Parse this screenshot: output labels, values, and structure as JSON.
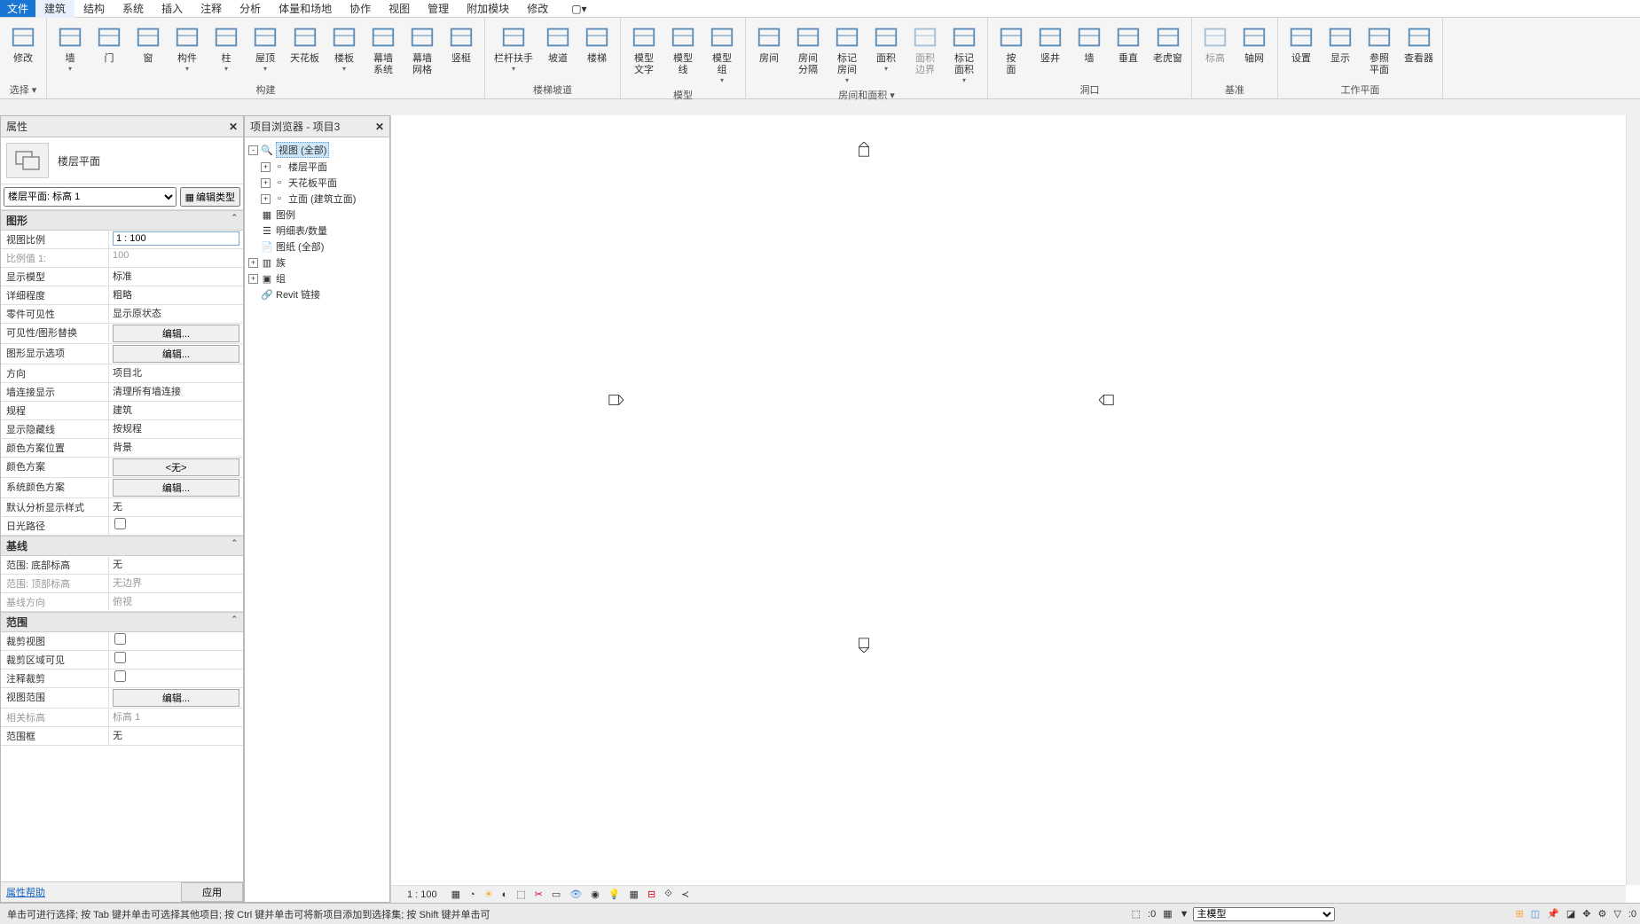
{
  "menu": {
    "file": "文件",
    "items": [
      "建筑",
      "结构",
      "系统",
      "插入",
      "注释",
      "分析",
      "体量和场地",
      "协作",
      "视图",
      "管理",
      "附加模块",
      "修改"
    ]
  },
  "ribbon": {
    "groups": [
      {
        "label": "选择 ▾",
        "buttons": [
          {
            "label": "修改",
            "icon": "cursor"
          }
        ]
      },
      {
        "label": "构建",
        "buttons": [
          {
            "label": "墙",
            "icon": "wall",
            "dd": true
          },
          {
            "label": "门",
            "icon": "door"
          },
          {
            "label": "窗",
            "icon": "window"
          },
          {
            "label": "构件",
            "icon": "component",
            "dd": true
          },
          {
            "label": "柱",
            "icon": "column",
            "dd": true
          },
          {
            "label": "屋顶",
            "icon": "roof",
            "dd": true
          },
          {
            "label": "天花板",
            "icon": "ceiling"
          },
          {
            "label": "楼板",
            "icon": "floor",
            "dd": true
          },
          {
            "label": "幕墙\n系统",
            "icon": "curtain-sys"
          },
          {
            "label": "幕墙\n网格",
            "icon": "curtain-grid"
          },
          {
            "label": "竖梃",
            "icon": "mullion"
          }
        ]
      },
      {
        "label": "楼梯坡道",
        "buttons": [
          {
            "label": "栏杆扶手",
            "icon": "railing",
            "dd": true
          },
          {
            "label": "坡道",
            "icon": "ramp"
          },
          {
            "label": "楼梯",
            "icon": "stair"
          }
        ]
      },
      {
        "label": "模型",
        "buttons": [
          {
            "label": "模型\n文字",
            "icon": "model-text"
          },
          {
            "label": "模型\n线",
            "icon": "model-line"
          },
          {
            "label": "模型\n组",
            "icon": "model-group",
            "dd": true
          }
        ]
      },
      {
        "label": "房间和面积 ▾",
        "buttons": [
          {
            "label": "房间",
            "icon": "room"
          },
          {
            "label": "房间\n分隔",
            "icon": "room-sep"
          },
          {
            "label": "标记\n房间",
            "icon": "tag-room",
            "dd": true
          },
          {
            "label": "面积",
            "icon": "area",
            "dd": true
          },
          {
            "label": "面积\n边界",
            "icon": "area-bound",
            "disabled": true
          },
          {
            "label": "标记\n面积",
            "icon": "tag-area",
            "dd": true
          }
        ]
      },
      {
        "label": "洞口",
        "buttons": [
          {
            "label": "按\n面",
            "icon": "by-face"
          },
          {
            "label": "竖井",
            "icon": "shaft"
          },
          {
            "label": "墙",
            "icon": "wall-open"
          },
          {
            "label": "垂直",
            "icon": "vertical"
          },
          {
            "label": "老虎窗",
            "icon": "dormer"
          }
        ]
      },
      {
        "label": "基准",
        "buttons": [
          {
            "label": "标高",
            "icon": "level",
            "disabled": true
          },
          {
            "label": "轴网",
            "icon": "grid"
          }
        ]
      },
      {
        "label": "工作平面",
        "buttons": [
          {
            "label": "设置",
            "icon": "set"
          },
          {
            "label": "显示",
            "icon": "show"
          },
          {
            "label": "参照\n平面",
            "icon": "ref-plane"
          },
          {
            "label": "查看器",
            "icon": "viewer"
          }
        ]
      }
    ]
  },
  "properties": {
    "title": "属性",
    "type_name": "楼层平面",
    "selector": "楼层平面: 标高 1",
    "edit_type": "编辑类型",
    "sections": [
      {
        "name": "图形",
        "rows": [
          {
            "k": "视图比例",
            "v": "1 : 100",
            "input": true
          },
          {
            "k": "比例值 1:",
            "v": "100",
            "dim": true
          },
          {
            "k": "显示模型",
            "v": "标准"
          },
          {
            "k": "详细程度",
            "v": "粗略"
          },
          {
            "k": "零件可见性",
            "v": "显示原状态"
          },
          {
            "k": "可见性/图形替换",
            "v": "编辑...",
            "btn": true
          },
          {
            "k": "图形显示选项",
            "v": "编辑...",
            "btn": true
          },
          {
            "k": "方向",
            "v": "项目北"
          },
          {
            "k": "墙连接显示",
            "v": "清理所有墙连接"
          },
          {
            "k": "规程",
            "v": "建筑"
          },
          {
            "k": "显示隐藏线",
            "v": "按规程"
          },
          {
            "k": "颜色方案位置",
            "v": "背景"
          },
          {
            "k": "颜色方案",
            "v": "<无>",
            "btn": true
          },
          {
            "k": "系统颜色方案",
            "v": "编辑...",
            "btn": true
          },
          {
            "k": "默认分析显示样式",
            "v": "无"
          },
          {
            "k": "日光路径",
            "v": "",
            "chk": true
          }
        ]
      },
      {
        "name": "基线",
        "rows": [
          {
            "k": "范围: 底部标高",
            "v": "无"
          },
          {
            "k": "范围: 顶部标高",
            "v": "无边界",
            "dim": true
          },
          {
            "k": "基线方向",
            "v": "俯视",
            "dim": true
          }
        ]
      },
      {
        "name": "范围",
        "rows": [
          {
            "k": "裁剪视图",
            "v": "",
            "chk": true
          },
          {
            "k": "裁剪区域可见",
            "v": "",
            "chk": true
          },
          {
            "k": "注释裁剪",
            "v": "",
            "chk": true
          },
          {
            "k": "视图范围",
            "v": "编辑...",
            "btn": true
          },
          {
            "k": "相关标高",
            "v": "标高 1",
            "dim": true
          },
          {
            "k": "范围框",
            "v": "无"
          }
        ]
      }
    ],
    "help": "属性帮助",
    "apply": "应用"
  },
  "browser": {
    "title": "项目浏览器 - 项目3",
    "tree": [
      {
        "label": "视图 (全部)",
        "icon": "views",
        "exp": "-",
        "indent": 0,
        "sel": true
      },
      {
        "label": "楼层平面",
        "icon": "none",
        "exp": "+",
        "indent": 1
      },
      {
        "label": "天花板平面",
        "icon": "none",
        "exp": "+",
        "indent": 1
      },
      {
        "label": "立面 (建筑立面)",
        "icon": "none",
        "exp": "+",
        "indent": 1
      },
      {
        "label": "图例",
        "icon": "legend",
        "exp": "",
        "indent": 0
      },
      {
        "label": "明细表/数量",
        "icon": "schedule",
        "exp": "",
        "indent": 0
      },
      {
        "label": "图纸 (全部)",
        "icon": "sheets",
        "exp": "",
        "indent": 0
      },
      {
        "label": "族",
        "icon": "families",
        "exp": "+",
        "indent": 0
      },
      {
        "label": "组",
        "icon": "groups",
        "exp": "+",
        "indent": 0
      },
      {
        "label": "Revit 链接",
        "icon": "link",
        "exp": "",
        "indent": 0
      }
    ]
  },
  "viewbar": {
    "scale": "1 : 100"
  },
  "status": {
    "hint": "单击可进行选择; 按 Tab 键并单击可选择其他项目; 按 Ctrl 键并单击可将新项目添加到选择集; 按 Shift 键并单击可",
    "count": ":0",
    "filter": "主模型"
  }
}
